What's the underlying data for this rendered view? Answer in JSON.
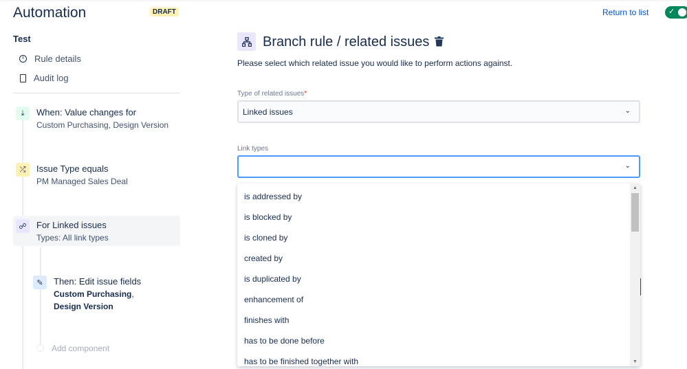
{
  "header": {
    "title": "Automation",
    "badge": "DRAFT",
    "return_link": "Return to list",
    "toggle_on": true
  },
  "sidebar": {
    "rule_name": "Test",
    "nav": [
      {
        "label": "Rule details",
        "icon": "info-icon"
      },
      {
        "label": "Audit log",
        "icon": "document-icon"
      }
    ],
    "steps": [
      {
        "title": "When: Value changes for",
        "subtitle": "Custom Purchasing, Design Version",
        "icon": "trigger-icon"
      },
      {
        "title": "Issue Type equals",
        "subtitle": "PM Managed Sales Deal",
        "icon": "shuffle-icon"
      },
      {
        "title": "For Linked issues",
        "subtitle": "Types: All link types",
        "icon": "branch-icon"
      },
      {
        "title": "Then: Edit issue fields",
        "subtitle_bold1": "Custom Purchasing",
        "subtitle_sep": ", ",
        "subtitle_bold2": "Design Version",
        "icon": "pencil-icon"
      }
    ],
    "add_component": "Add component"
  },
  "main": {
    "title": "Branch rule / related issues",
    "description": "Please select which related issue you would like to perform actions against.",
    "type_label": "Type of related issues",
    "required_mark": "*",
    "type_value": "Linked issues",
    "link_types_label": "Link types",
    "link_types_value": "",
    "options": [
      "is addressed by",
      "is blocked by",
      "is cloned by",
      "created by",
      "is duplicated by",
      "enhancement of",
      "finishes with",
      "has to be done before",
      "has to be finished together with"
    ]
  }
}
